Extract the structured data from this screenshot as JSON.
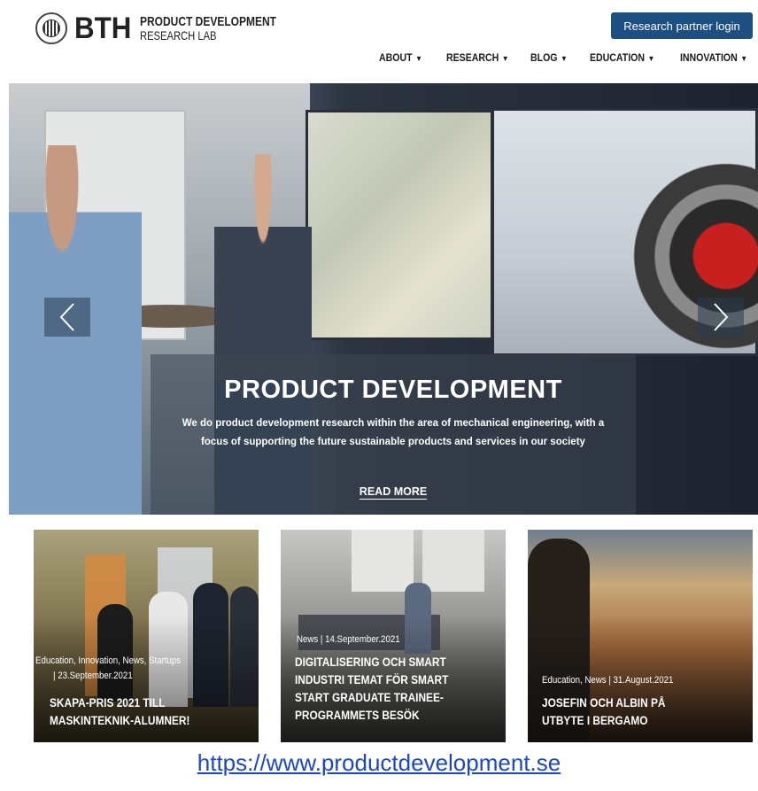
{
  "header": {
    "logo": {
      "brand": "BTH",
      "line1": "PRODUCT DEVELOPMENT",
      "line2": "RESEARCH LAB"
    },
    "login_label": "Research partner login"
  },
  "nav": {
    "items": [
      {
        "label": "ABOUT"
      },
      {
        "label": "RESEARCH"
      },
      {
        "label": "BLOG"
      },
      {
        "label": "EDUCATION"
      },
      {
        "label": "INNOVATION"
      }
    ]
  },
  "hero": {
    "title": "PRODUCT DEVELOPMENT",
    "description": "We do product development research within the area of mechanical engineering, with a focus of supporting the future sustainable products and services in our society",
    "read_more": "READ MORE"
  },
  "cards": [
    {
      "meta_line1": "Education, Innovation, News, Startups",
      "meta_line2": "| 23.September.2021",
      "title_line1": "SKAPA-PRIS 2021 TILL",
      "title_line2": "MASKINTEKNIK-ALUMNER!"
    },
    {
      "meta_line1": "News | 14.September.2021",
      "title_line1": "DIGITALISERING OCH SMART",
      "title_line2": "INDUSTRI TEMAT FÖR SMART",
      "title_line3": "START GRADUATE TRAINEE-",
      "title_line4": "PROGRAMMETS BESÖK"
    },
    {
      "meta_line1": "Education, News | 31.August.2021",
      "title_line1": "JOSEFIN OCH ALBIN PÅ",
      "title_line2": "UTBYTE I BERGAMO"
    }
  ],
  "footer": {
    "url": "https://www.productdevelopment.se"
  },
  "colors": {
    "login_bg": "#1e4f82",
    "link": "#1c47c4",
    "nav_text": "#1a1a1a"
  }
}
